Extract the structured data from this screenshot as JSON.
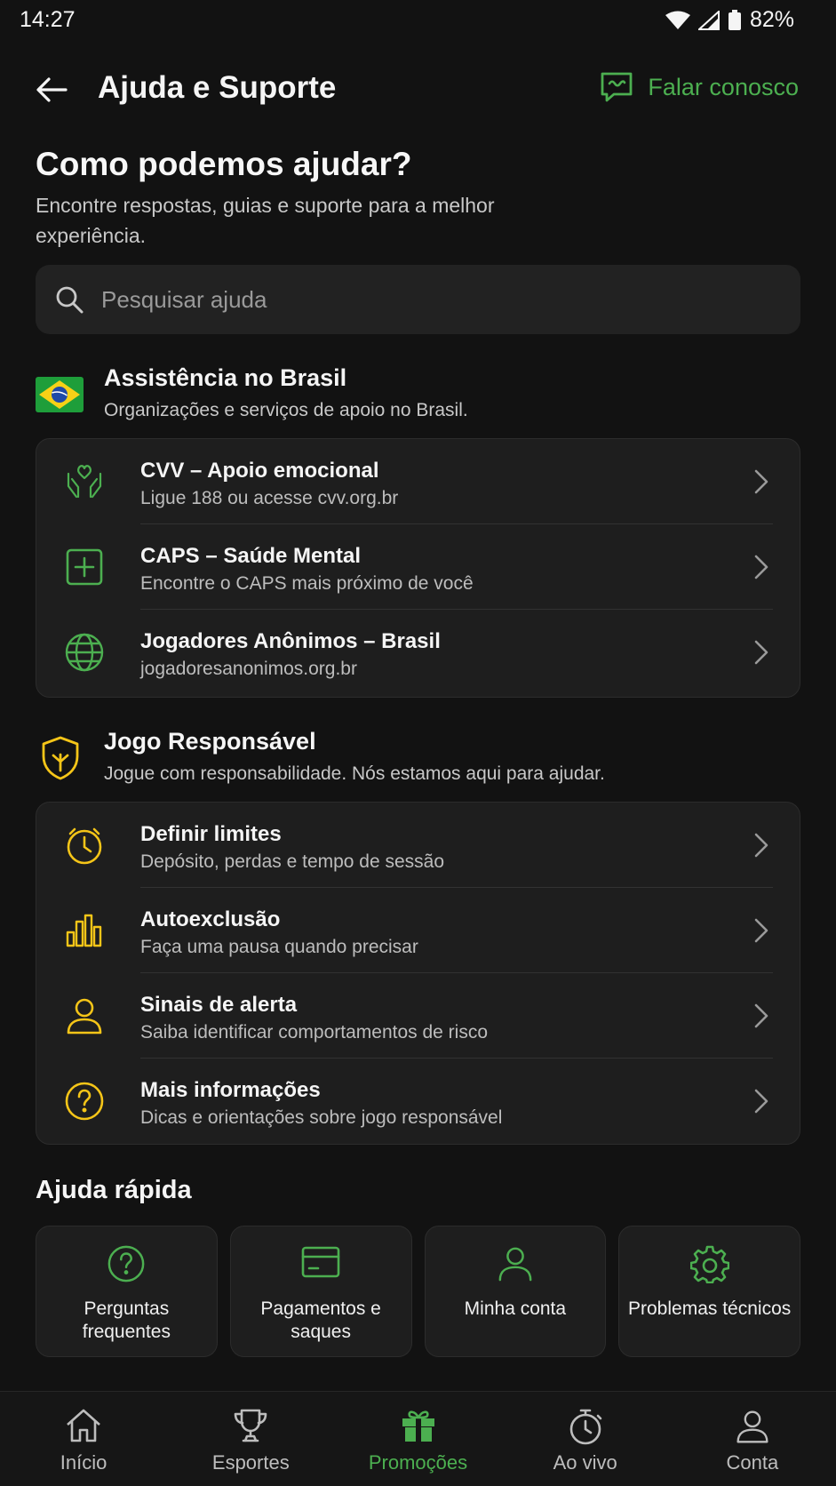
{
  "status_bar": {
    "time": "14:27",
    "battery": "82%"
  },
  "app_bar": {
    "title": "Ajuda e Suporte",
    "contact_label": "Falar conosco"
  },
  "header": {
    "headline": "Como podemos ajudar?",
    "subtitle": "Encontre respostas, guias e suporte para a melhor experiência."
  },
  "search": {
    "placeholder": "Pesquisar ajuda"
  },
  "brazil_section": {
    "title": "Assistência no Brasil",
    "subtitle": "Organizações e serviços de apoio no Brasil.",
    "icon": "brazil-flag-icon",
    "items": [
      {
        "title": "CVV – Apoio emocional",
        "subtitle": "Ligue 188 ou acesse cvv.org.br",
        "icon": "hands-heart-icon"
      },
      {
        "title": "CAPS – Saúde Mental",
        "subtitle": "Encontre o CAPS mais próximo de você",
        "icon": "medical-cross-icon"
      },
      {
        "title": "Jogadores Anônimos – Brasil",
        "subtitle": "jogadoresanonimos.org.br",
        "icon": "globe-icon"
      }
    ]
  },
  "responsible_section": {
    "title": "Jogo Responsável",
    "subtitle": "Jogue com responsabilidade. Nós estamos aqui para ajudar.",
    "icon": "shield-icon",
    "items": [
      {
        "title": "Definir limites",
        "subtitle": "Depósito, perdas e tempo de sessão",
        "icon": "timer-icon"
      },
      {
        "title": "Autoexclusão",
        "subtitle": "Faça uma pausa quando precisar",
        "icon": "bar-chart-icon"
      },
      {
        "title": "Sinais de alerta",
        "subtitle": "Saiba identificar comportamentos de risco",
        "icon": "user-icon"
      },
      {
        "title": "Mais informações",
        "subtitle": "Dicas e orientações sobre jogo responsável",
        "icon": "question-circle-icon"
      }
    ]
  },
  "quick_help": {
    "title": "Ajuda rápida",
    "tiles": [
      {
        "label": "Perguntas frequentes",
        "icon": "question-circle-icon"
      },
      {
        "label": "Pagamentos e saques",
        "icon": "credit-card-icon"
      },
      {
        "label": "Minha conta",
        "icon": "user-icon"
      },
      {
        "label": "Problemas técnicos",
        "icon": "gear-icon"
      }
    ]
  },
  "bottom_nav": {
    "active": "Promoções",
    "items": [
      {
        "label": "Início",
        "icon": "home-icon"
      },
      {
        "label": "Esportes",
        "icon": "trophy-icon"
      },
      {
        "label": "Promoções",
        "icon": "gift-icon"
      },
      {
        "label": "Ao vivo",
        "icon": "stopwatch-icon"
      },
      {
        "label": "Conta",
        "icon": "user-icon"
      }
    ]
  },
  "colors": {
    "background": "#121212",
    "card": "#1e1e1e",
    "accent_green": "#4caf50",
    "accent_yellow": "#f5c518",
    "text_primary": "#f5f5f5",
    "text_secondary": "#bdbdbd"
  }
}
